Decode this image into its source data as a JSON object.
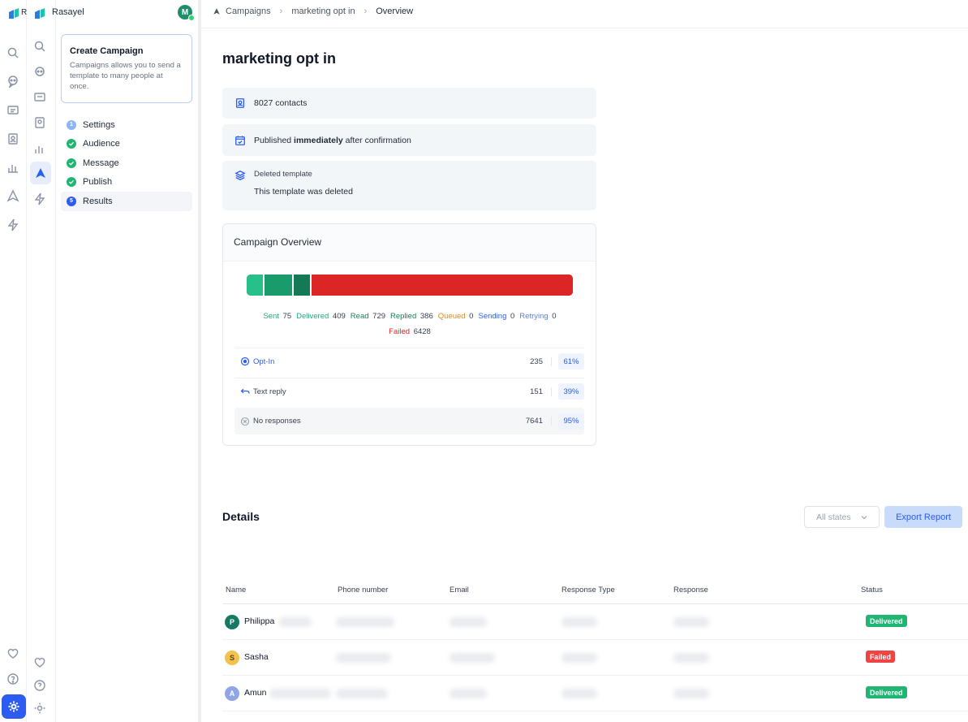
{
  "app": {
    "workspace_name": "Rasayel",
    "user_initial": "M",
    "brand_letter": "R"
  },
  "colors": {
    "accent": "#2c5cf0",
    "success": "#21b573",
    "danger": "#dc2626",
    "bar_sent": "#27c08a",
    "bar_delivered": "#1a9b6c",
    "bar_read": "#147a55"
  },
  "breadcrumb": {
    "items": [
      "Campaigns",
      "marketing opt in",
      "Overview"
    ]
  },
  "sidebar": {
    "card_title": "Create Campaign",
    "card_desc": "Campaigns allows you to send a template to many people at once.",
    "steps": [
      {
        "label": "Settings",
        "num": "1"
      },
      {
        "label": "Audience",
        "state": "done"
      },
      {
        "label": "Message",
        "state": "done"
      },
      {
        "label": "Publish",
        "state": "done"
      },
      {
        "label": "Results",
        "num": "5"
      }
    ]
  },
  "page": {
    "title": "marketing opt in"
  },
  "info": {
    "contacts": "8027 contacts",
    "published_pre": "Published ",
    "published_bold": "immediately",
    "published_post": " after confirmation",
    "template_caption": "Deleted template",
    "template_text": "This template was deleted"
  },
  "overview": {
    "title": "Campaign Overview",
    "bar_fractions": {
      "sent": 0.055,
      "delivered": 0.09,
      "read": 0.055,
      "failed": 0.8
    },
    "legend": [
      {
        "label": "Sent",
        "value": "75",
        "color": "#27a77a"
      },
      {
        "label": "Delivered",
        "value": "409",
        "color": "#27a77a"
      },
      {
        "label": "Read",
        "value": "729",
        "color": "#1a7f57"
      },
      {
        "label": "Replied",
        "value": "386",
        "color": "#1a7f57"
      },
      {
        "label": "Queued",
        "value": "0",
        "color": "#e08a1e"
      },
      {
        "label": "Sending",
        "value": "0",
        "color": "#2c5cf0"
      },
      {
        "label": "Retrying",
        "value": "0",
        "color": "#5b7fe8"
      }
    ],
    "failed": {
      "label": "Failed",
      "value": "6428",
      "color": "#dc2626"
    },
    "responses": [
      {
        "label": "Opt-In",
        "count": "235",
        "pct": "61%"
      },
      {
        "label": "Text reply",
        "count": "151",
        "pct": "39%"
      },
      {
        "label": "No responses",
        "count": "7641",
        "pct": "95%"
      }
    ]
  },
  "details": {
    "title": "Details",
    "filter": "All states",
    "export": "Export Report",
    "columns": [
      "Name",
      "Phone number",
      "Email",
      "Response Type",
      "Response",
      "Status"
    ],
    "rows": [
      {
        "initial": "P",
        "name": "Philippa",
        "status": "Delivered",
        "avatar_color": "#157a64",
        "status_color": "#21b573"
      },
      {
        "initial": "S",
        "name": "Sasha",
        "status": "Failed",
        "avatar_color": "#f2c14e",
        "status_color": "#ef4444"
      },
      {
        "initial": "A",
        "name": "Amun",
        "status": "Delivered",
        "avatar_color": "#8fa6e6",
        "status_color": "#21b573"
      }
    ]
  }
}
